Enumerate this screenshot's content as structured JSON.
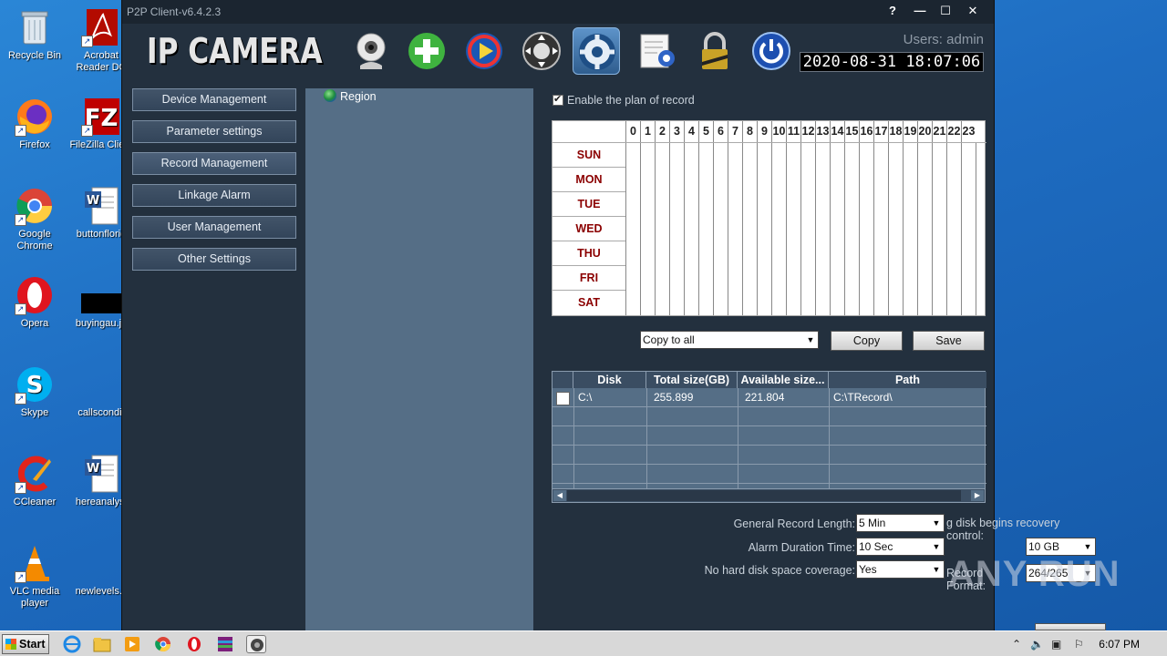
{
  "desktop": {
    "icons": [
      {
        "label": "Recycle Bin"
      },
      {
        "label": "Firefox"
      },
      {
        "label": "Google Chrome"
      },
      {
        "label": "Opera"
      },
      {
        "label": "Skype"
      },
      {
        "label": "CCleaner"
      },
      {
        "label": "VLC media player"
      },
      {
        "label": "Acrobat Reader DC"
      },
      {
        "label": "FileZilla Client"
      },
      {
        "label": "buttonflorid"
      },
      {
        "label": "buyingau.jp"
      },
      {
        "label": "callscondit"
      },
      {
        "label": "hereanalysi"
      },
      {
        "label": "newlevels.c"
      }
    ]
  },
  "window": {
    "title": "P2P Client-v6.4.2.3",
    "buttons": {
      "help": "?",
      "minimize": "—",
      "maximize": "☐",
      "close": "✕"
    }
  },
  "header": {
    "logo": "IP CAMERA",
    "user": "Users: admin",
    "datetime": "2020-08-31  18:07:06"
  },
  "nav": {
    "items": [
      {
        "label": "Device Management"
      },
      {
        "label": "Parameter settings"
      },
      {
        "label": "Record Management"
      },
      {
        "label": "Linkage Alarm"
      },
      {
        "label": "User Management"
      },
      {
        "label": "Other Settings"
      }
    ]
  },
  "tree": {
    "root": "Region"
  },
  "record": {
    "enable_label": "Enable the plan of record",
    "enable_checked": true,
    "hours": [
      "0",
      "1",
      "2",
      "3",
      "4",
      "5",
      "6",
      "7",
      "8",
      "9",
      "10",
      "11",
      "12",
      "13",
      "14",
      "15",
      "16",
      "17",
      "18",
      "19",
      "20",
      "21",
      "22",
      "23"
    ],
    "days": [
      "SUN",
      "MON",
      "TUE",
      "WED",
      "THU",
      "FRI",
      "SAT"
    ],
    "copy_select": "Copy to all",
    "copy_button": "Copy",
    "save_button": "Save"
  },
  "disks": {
    "headers": [
      "Disk",
      "Total size(GB)",
      "Available size...",
      "Path"
    ],
    "rows": [
      {
        "disk": "C:\\",
        "total": "255.899",
        "available": "221.804",
        "path": "C:\\TRecord\\"
      }
    ]
  },
  "settings": {
    "general_length_label": "General Record Length:",
    "general_length_value": "5 Min",
    "alarm_duration_label": "Alarm Duration Time:",
    "alarm_duration_value": "10 Sec",
    "no_space_label": "No hard disk space coverage:",
    "no_space_value": "Yes",
    "recovery_label": "g disk begins recovery control:",
    "recovery_value": "10 GB",
    "format_label": "Record Format:",
    "format_value": "264/265"
  },
  "taskbar": {
    "start": "Start",
    "time": "6:07 PM"
  },
  "watermark": "ANY RUN",
  "colors": {
    "window_bg": "#23303e",
    "tree_bg": "#556e86",
    "day_label": "#8b0000",
    "desktop": "#1f6fc5"
  }
}
